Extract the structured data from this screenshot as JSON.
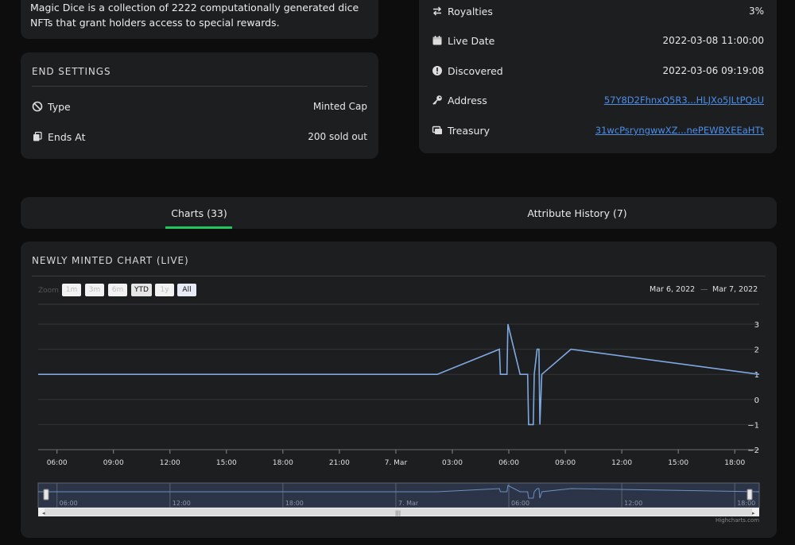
{
  "description": "Magic Dice is a collection of 2222 computationally generated dice NFTs that grant holders access to special rewards.",
  "end_settings": {
    "title": "END SETTINGS",
    "rows": [
      {
        "label": "Type",
        "value": "Minted Cap",
        "icon": "ban-icon"
      },
      {
        "label": "Ends At",
        "value": "200 sold out",
        "icon": "copy-icon"
      }
    ]
  },
  "info": {
    "royalties": {
      "label": "Royalties",
      "value": "3%"
    },
    "live_date": {
      "label": "Live Date",
      "value": "2022-03-08 11:00:00"
    },
    "discovered": {
      "label": "Discovered",
      "value": "2022-03-06 09:19:08"
    },
    "address": {
      "label": "Address",
      "value": "57Y8D2FhnxQ5R3...HLJXo5JLtPQsU"
    },
    "treasury": {
      "label": "Treasury",
      "value": "31wcPsryngwwXZ...nePEWBXEEaHTt"
    }
  },
  "tabs": [
    {
      "label": "Charts (33)",
      "active": true
    },
    {
      "label": "Attribute History (7)",
      "active": false
    }
  ],
  "chart_section": {
    "title": "NEWLY MINTED CHART (LIVE)",
    "zoom_label": "Zoom",
    "zoom_buttons": [
      {
        "label": "1m",
        "state": "disabled"
      },
      {
        "label": "3m",
        "state": "disabled"
      },
      {
        "label": "6m",
        "state": "disabled"
      },
      {
        "label": "YTD",
        "state": "enabled"
      },
      {
        "label": "1y",
        "state": "disabled"
      },
      {
        "label": "All",
        "state": "selected"
      }
    ],
    "range_from": "Mar 6, 2022",
    "range_sep": "—",
    "range_to": "Mar 7, 2022",
    "credit": "Highcharts.com"
  },
  "chart_data": {
    "type": "line",
    "title": "NEWLY MINTED CHART (LIVE)",
    "xlabel": "",
    "ylabel": "",
    "ylim": [
      -2,
      3
    ],
    "yticks": [
      3,
      2,
      1,
      0,
      -1,
      -2
    ],
    "xticks": [
      "06:00",
      "09:00",
      "12:00",
      "15:00",
      "18:00",
      "21:00",
      "7. Mar",
      "03:00",
      "06:00",
      "09:00",
      "12:00",
      "15:00",
      "18:00"
    ],
    "xlim_hours": [
      5.0,
      43.3
    ],
    "x_hours": [
      5.0,
      26.2,
      29.5,
      29.55,
      29.9,
      29.95,
      30.6,
      31.0,
      31.05,
      31.3,
      31.35,
      31.5,
      31.6,
      31.65,
      31.75,
      33.3,
      43.3
    ],
    "values": [
      1,
      1,
      2,
      1,
      1,
      3,
      1,
      1,
      -1,
      -1,
      1,
      2,
      2,
      -1,
      1,
      2,
      1
    ],
    "navigator_labels": [
      "06:00",
      "12:00",
      "18:00",
      "7. Mar",
      "06:00",
      "12:00",
      "18:00"
    ],
    "navigator_hours": [
      6,
      12,
      18,
      24,
      30,
      36,
      42
    ],
    "grid": true,
    "line_color": "#7fa8e0"
  }
}
